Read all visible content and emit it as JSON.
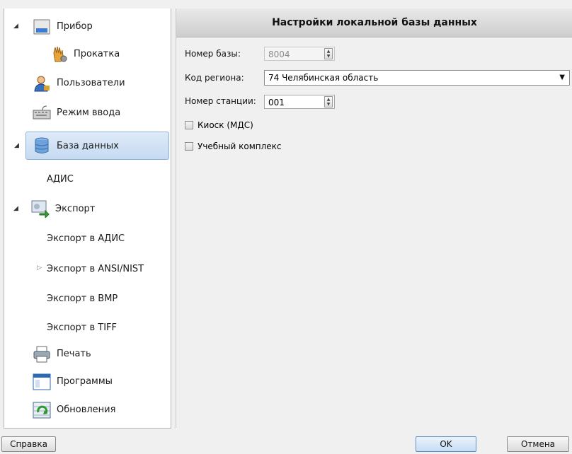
{
  "tree": {
    "items": [
      {
        "label": "Прибор",
        "icon": "device-icon"
      },
      {
        "label": "Прокатка",
        "icon": "hand-gear-icon"
      },
      {
        "label": "Пользователи",
        "icon": "user-icon"
      },
      {
        "label": "Режим ввода",
        "icon": "keyboard-icon"
      },
      {
        "label": "База данных",
        "icon": "database-icon"
      },
      {
        "label": "АДИС"
      },
      {
        "label": "Экспорт",
        "icon": "export-icon"
      },
      {
        "label": "Экспорт в АДИС"
      },
      {
        "label": "Экспорт в ANSI/NIST"
      },
      {
        "label": "Экспорт в BMP"
      },
      {
        "label": "Экспорт в TIFF"
      },
      {
        "label": "Печать",
        "icon": "printer-icon"
      },
      {
        "label": "Программы",
        "icon": "window-icon"
      },
      {
        "label": "Обновления",
        "icon": "update-icon"
      }
    ]
  },
  "panel": {
    "title": "Настройки локальной базы данных",
    "db_number_label": "Номер базы:",
    "db_number_value": "8004",
    "region_label": "Код региона:",
    "region_value": "74 Челябинская область",
    "station_label": "Номер станции:",
    "station_value": "001",
    "kiosk_label": "Киоск (МДС)",
    "training_label": "Учебный комплекс"
  },
  "buttons": {
    "help": "Справка",
    "ok": "OK",
    "cancel": "Отмена"
  },
  "colors": {
    "selection": "#c5daf2",
    "accent": "#5f8fc6"
  }
}
